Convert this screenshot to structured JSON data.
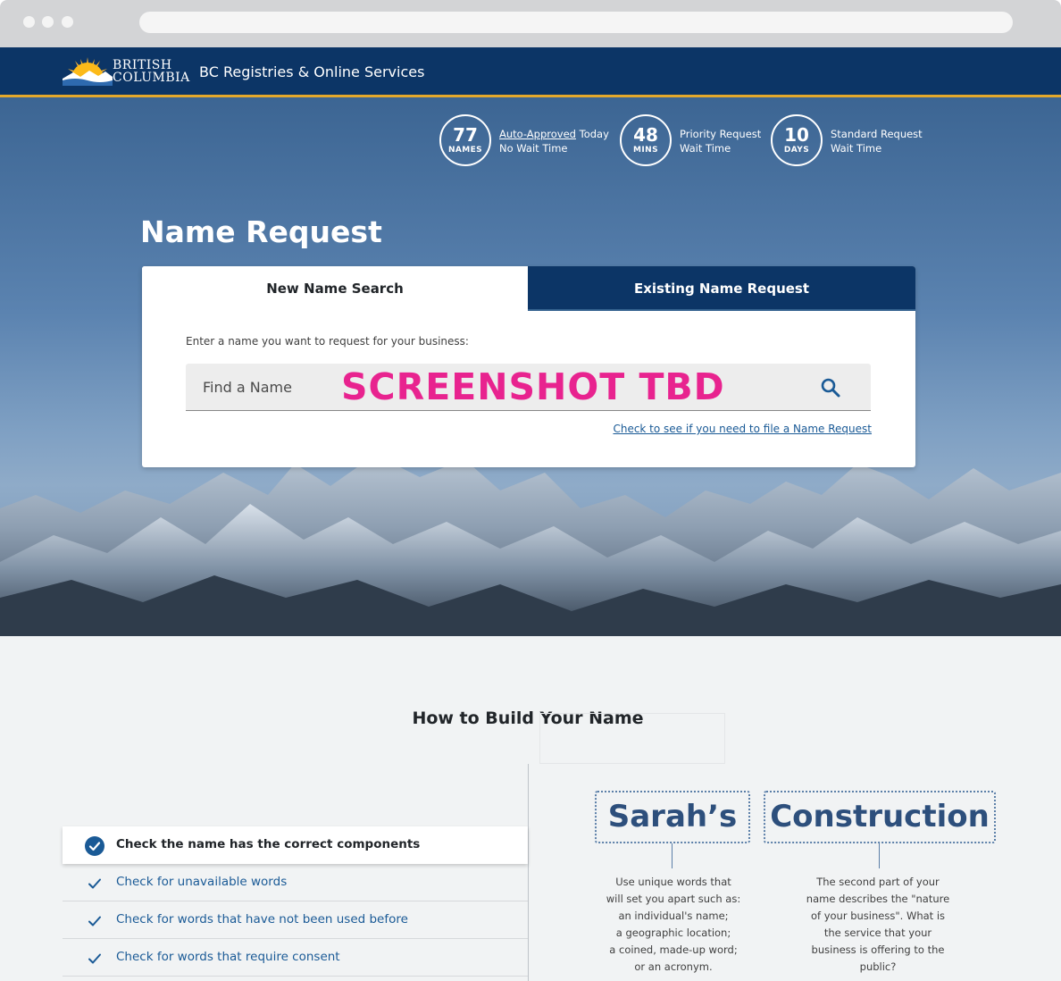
{
  "header": {
    "logo_line1": "BRITISH",
    "logo_line2": "COLUMBIA",
    "title": "BC Registries & Online Services"
  },
  "stats": [
    {
      "number": "77",
      "unit": "NAMES",
      "line1_link": "Auto-Approved",
      "line1_rest": " Today",
      "line2": "No Wait Time"
    },
    {
      "number": "48",
      "unit": "MINS",
      "line1": "Priority Request",
      "line2": "Wait Time"
    },
    {
      "number": "10",
      "unit": "DAYS",
      "line1": "Standard Request",
      "line2": "Wait Time"
    }
  ],
  "page_title": "Name Request",
  "tabs": {
    "new": "New Name Search",
    "existing": "Existing Name Request"
  },
  "search": {
    "label": "Enter a name you want to request for your business:",
    "placeholder": "Find a Name",
    "overlay": "SCREENSHOT TBD",
    "check_link": "Check to see if you need to file a Name Request"
  },
  "build": {
    "title": "How to Build Your Name",
    "checks": [
      "Check the name has the correct components",
      "Check for unavailable words",
      "Check for words that have not been used before",
      "Check for words that require consent"
    ],
    "example_distinctive": "Sarah’s",
    "example_descriptive": "Construction",
    "desc_distinctive": [
      "Use unique words that",
      "will set you apart such as:",
      "an individual's name;",
      "a geographic location;",
      "a coined, made-up word;",
      "or an acronym."
    ],
    "desc_descriptive": [
      "The second part of your",
      "name describes the \"nature",
      "of your business\". What is",
      "the service that your",
      "business is offering to the",
      "public?"
    ]
  },
  "colors": {
    "header_bg": "#0c3566",
    "header_accent": "#e3a82b",
    "link": "#1a5a96",
    "overlay": "#e8238f"
  }
}
